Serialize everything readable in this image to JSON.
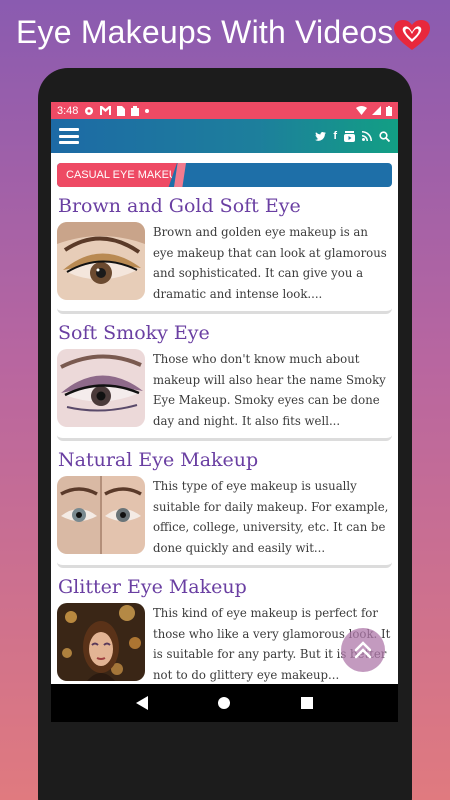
{
  "promo": {
    "title": "Eye Makeups With Videos",
    "heart_icon": "heart-icon"
  },
  "statusbar": {
    "time": "3:48",
    "icons": [
      "settings-icon",
      "gmail-icon",
      "sim-icon",
      "storage-icon",
      "dot-icon",
      "wifi-icon",
      "signal-icon",
      "battery-icon"
    ],
    "color": "#ee4a64"
  },
  "appbar": {
    "menu_icon": "menu-icon",
    "social_icons": [
      "twitter-icon",
      "facebook-icon",
      "youtube-icon",
      "rss-icon",
      "search-icon"
    ]
  },
  "category": {
    "label": "CASUAL EYE MAKEUP",
    "colors": {
      "label": "#ee4a64",
      "bar": "#1e6fa8"
    }
  },
  "articles": [
    {
      "title": "Brown and Gold Soft Eye",
      "excerpt": "Brown and golden eye makeup is an eye makeup that can look at glamorous and sophisticated. It can give you a dramatic and intense look....",
      "thumb_icon": "brown-gold-eye-thumbnail"
    },
    {
      "title": "Soft Smoky Eye",
      "excerpt": "Those who don't know much about makeup will also hear the name Smoky Eye Makeup. Smoky eyes can be done day and night. It also fits well...",
      "thumb_icon": "smoky-eye-thumbnail"
    },
    {
      "title": "Natural Eye Makeup",
      "excerpt": "This type of eye makeup is usually suitable for daily makeup. For example, office, college, university, etc. It can be done quickly and easily wit...",
      "thumb_icon": "natural-eye-thumbnail"
    },
    {
      "title": "Glitter Eye Makeup",
      "excerpt": "This kind of eye makeup is perfect for those who like a very glamorous look. It is suitable for any party. But it is better not to do glittery eye makeup...",
      "thumb_icon": "glitter-eye-thumbnail"
    }
  ],
  "fab": {
    "icon": "double-chevron-up-icon"
  },
  "navbar": {
    "icons": [
      "back-icon",
      "home-icon",
      "recents-icon"
    ]
  }
}
